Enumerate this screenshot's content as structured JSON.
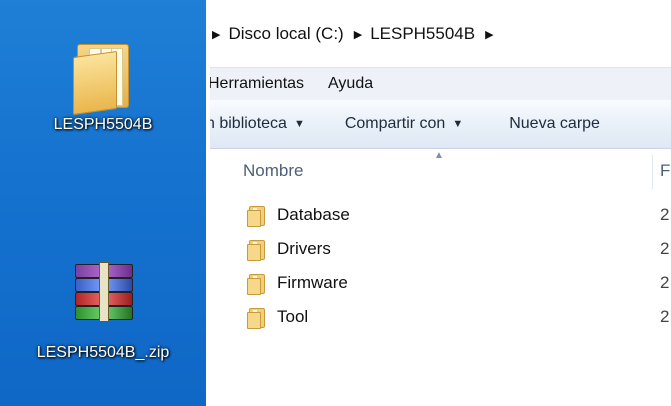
{
  "desktop": {
    "icons": [
      {
        "label": "LESPH5504B",
        "icon": "folder-icon"
      },
      {
        "label": "LESPH5504B_.zip",
        "icon": "winrar-archive-icon"
      }
    ]
  },
  "explorer": {
    "breadcrumb": [
      "Disco local (C:)",
      "LESPH5504B"
    ],
    "menu": [
      "Herramientas",
      "Ayuda"
    ],
    "toolbar": {
      "library": "n biblioteca",
      "share": "Compartir con",
      "new_folder": "Nueva carpe"
    },
    "columns": {
      "name": "Nombre",
      "date": "F"
    },
    "files": [
      {
        "name": "Database",
        "date": "2"
      },
      {
        "name": "Drivers",
        "date": "2"
      },
      {
        "name": "Firmware",
        "date": "2"
      },
      {
        "name": "Tool",
        "date": "2"
      }
    ]
  },
  "colors": {
    "desktop": "#1572cf",
    "toolbar": "#e9f0f9",
    "menubar": "#eef2f8"
  }
}
